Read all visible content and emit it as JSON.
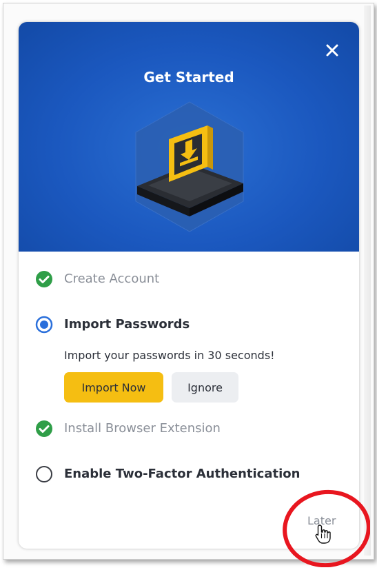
{
  "dialog": {
    "title": "Get Started",
    "close_icon": "close-icon"
  },
  "steps": [
    {
      "label": "Create Account",
      "status": "completed",
      "icon": "check-circle-icon"
    },
    {
      "label": "Import Passwords",
      "status": "active",
      "icon": "radio-selected-icon",
      "description": "Import your passwords in 30 seconds!",
      "primary_button": "Import Now",
      "secondary_button": "Ignore"
    },
    {
      "label": "Install Browser Extension",
      "status": "completed",
      "icon": "check-circle-icon"
    },
    {
      "label": "Enable Two-Factor Authentication",
      "status": "pending",
      "icon": "radio-empty-icon"
    }
  ],
  "footer": {
    "later_label": "Later"
  },
  "colors": {
    "hero_blue": "#1b58bf",
    "accent_yellow": "#f5be12",
    "success_green": "#2f9e48",
    "radio_blue": "#2a6fdb",
    "annotation_red": "#e8161f"
  }
}
